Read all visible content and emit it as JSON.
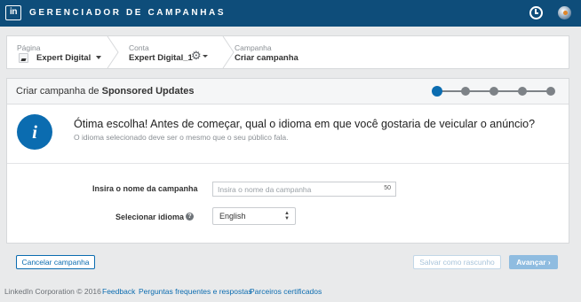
{
  "header": {
    "logo_text": "in",
    "app_title": "GERENCIADOR DE CAMPANHAS",
    "icons": [
      "clock-icon",
      "globe-icon"
    ]
  },
  "breadcrumb": {
    "page": {
      "label": "Página",
      "value": "Expert Digital"
    },
    "account": {
      "label": "Conta",
      "value": "Expert Digital_1"
    },
    "campaign": {
      "label": "Campanha",
      "value": "Criar campanha"
    }
  },
  "panel": {
    "title_prefix": "Criar campanha de ",
    "title_bold": "Sponsored Updates",
    "steps": {
      "total": 5,
      "current": 1
    }
  },
  "info": {
    "icon_glyph": "i",
    "title": "Ótima escolha! Antes de começar, qual o idioma em que você gostaria de veicular o anúncio?",
    "subtitle": "O idioma selecionado deve ser o mesmo que o seu público fala."
  },
  "form": {
    "name_label": "Insira o nome da campanha",
    "name_placeholder": "Insira o nome da campanha",
    "name_value": "",
    "name_counter": "50",
    "language_label": "Selecionar idioma",
    "help_glyph": "?",
    "language_value": "English"
  },
  "actions": {
    "cancel": "Cancelar campanha",
    "save_draft": "Salvar como rascunho",
    "next": "Avançar ›"
  },
  "footer": {
    "copyright": "LinkedIn Corporation © 2016",
    "links": [
      "Feedback",
      "Perguntas frequentes e respostas",
      "Parceiros certificados"
    ]
  },
  "colors": {
    "topbar": "#0e4d7a",
    "accent": "#0b6cb0",
    "next_button": "#8fbce0",
    "step_inactive": "#7d8287"
  }
}
